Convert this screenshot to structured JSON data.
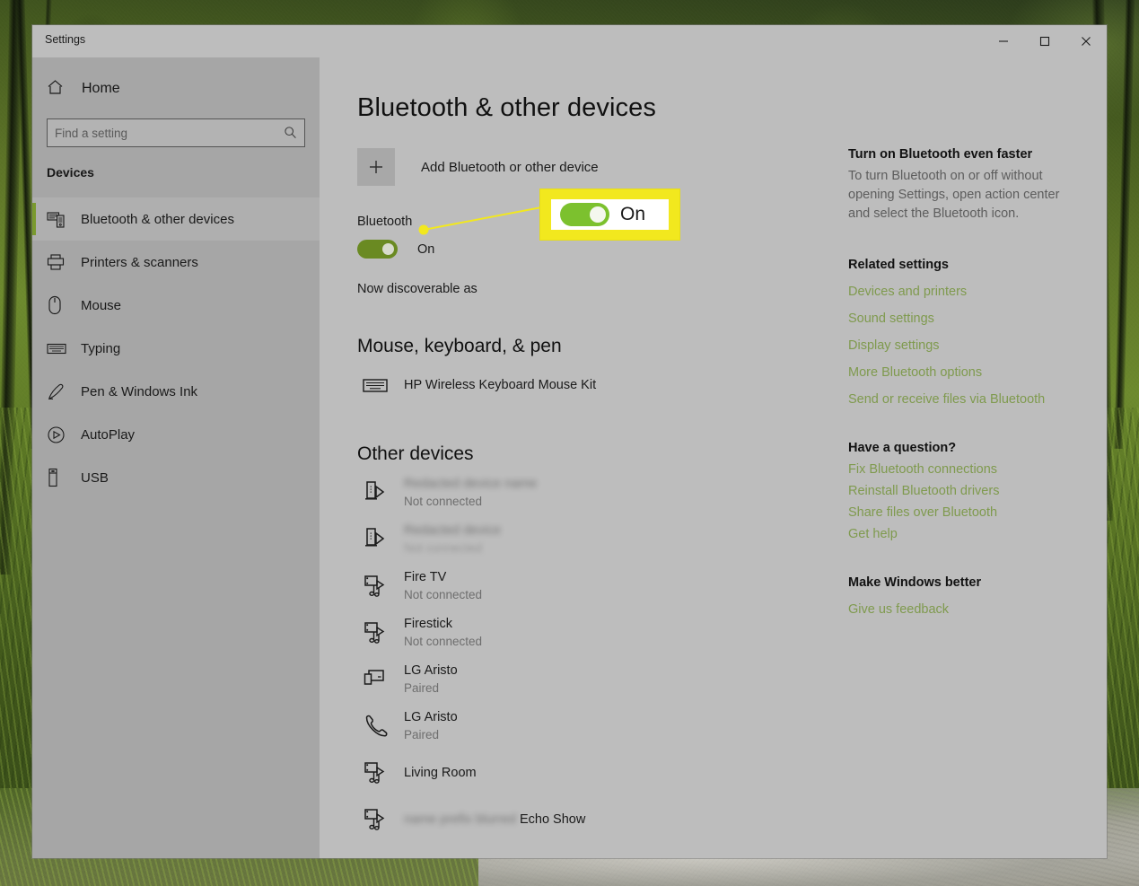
{
  "window": {
    "title": "Settings",
    "controls": {
      "minimize": "minimize-button",
      "maximize": "maximize-button",
      "close": "close-button"
    }
  },
  "sidebar": {
    "home_label": "Home",
    "search": {
      "placeholder": "Find a setting",
      "value": "",
      "icon": "search-icon"
    },
    "category_heading": "Devices",
    "items": [
      {
        "label": "Bluetooth & other devices",
        "icon": "bluetooth-devices-icon",
        "selected": true
      },
      {
        "label": "Printers & scanners",
        "icon": "printer-icon",
        "selected": false
      },
      {
        "label": "Mouse",
        "icon": "mouse-icon",
        "selected": false
      },
      {
        "label": "Typing",
        "icon": "keyboard-icon",
        "selected": false
      },
      {
        "label": "Pen & Windows Ink",
        "icon": "pen-icon",
        "selected": false
      },
      {
        "label": "AutoPlay",
        "icon": "autoplay-icon",
        "selected": false
      },
      {
        "label": "USB",
        "icon": "usb-icon",
        "selected": false
      }
    ]
  },
  "main": {
    "page_title": "Bluetooth & other devices",
    "add_device": {
      "label": "Add Bluetooth or other device",
      "icon": "plus-icon"
    },
    "bluetooth": {
      "label": "Bluetooth",
      "state": "On",
      "discoverable_text": "Now discoverable as"
    },
    "sections": [
      {
        "heading": "Mouse, keyboard, & pen",
        "devices": [
          {
            "name": "HP Wireless Keyboard Mouse Kit",
            "status": "",
            "icon": "keyboard-icon",
            "redacted": false
          }
        ]
      },
      {
        "heading": "Other devices",
        "devices": [
          {
            "name": "Redacted device name",
            "status": "Not connected",
            "icon": "speaker-cast-icon",
            "redacted": true
          },
          {
            "name": "Redacted device",
            "status": "Not connected",
            "icon": "speaker-cast-icon",
            "redacted": true
          },
          {
            "name": "Fire TV",
            "status": "Not connected",
            "icon": "media-audio-icon",
            "redacted": false
          },
          {
            "name": "Firestick",
            "status": "Not connected",
            "icon": "media-audio-icon",
            "redacted": false
          },
          {
            "name": "LG Aristo",
            "status": "Paired",
            "icon": "phone-monitor-icon",
            "redacted": false
          },
          {
            "name": "LG Aristo",
            "status": "Paired",
            "icon": "phone-handset-icon",
            "redacted": false
          },
          {
            "name": "Living Room",
            "status": "",
            "icon": "media-audio-icon",
            "redacted": false
          },
          {
            "name": "Echo Show",
            "status": "",
            "icon": "media-audio-icon",
            "redacted": false,
            "name_prefix_redacted": "name prefix blurred"
          }
        ]
      }
    ]
  },
  "right_panel": {
    "tip": {
      "heading": "Turn on Bluetooth even faster",
      "body": "To turn Bluetooth on or off without opening Settings, open action center and select the Bluetooth icon."
    },
    "related_settings": {
      "heading": "Related settings",
      "links": [
        "Devices and printers",
        "Sound settings",
        "Display settings",
        "More Bluetooth options",
        "Send or receive files via Bluetooth"
      ]
    },
    "help": {
      "heading": "Have a question?",
      "links": [
        "Fix Bluetooth connections",
        "Reinstall Bluetooth drivers",
        "Share files over Bluetooth",
        "Get help"
      ]
    },
    "feedback": {
      "heading": "Make Windows better",
      "links": [
        "Give us feedback"
      ]
    }
  },
  "callout": {
    "state_label": "On",
    "highlight_color": "#f2e81e",
    "toggle_color": "#7cc12e",
    "accent_color": "#7f9a4e",
    "toggle_on_color": "#6a8a22"
  }
}
